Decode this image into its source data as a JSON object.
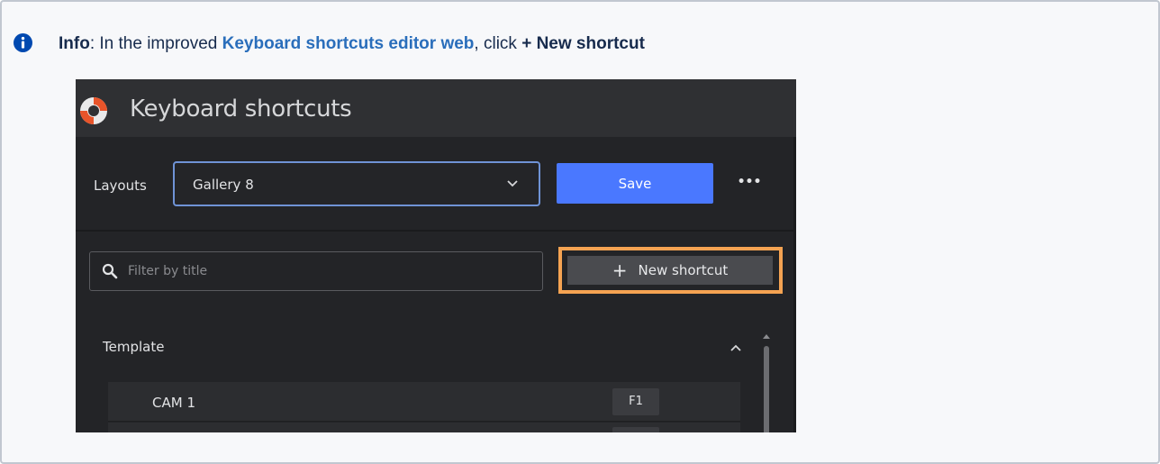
{
  "info": {
    "label": "Info",
    "sep": ": ",
    "text_before": "In the improved ",
    "link_text": "Keyboard shortcuts editor web",
    "text_middle": ", click ",
    "action_text": "+ New shortcut"
  },
  "app": {
    "title": "Keyboard shortcuts",
    "layouts_label": "Layouts",
    "layout_value": "Gallery 8",
    "save_label": "Save",
    "more_label": "•••",
    "filter_placeholder": "Filter by title",
    "new_shortcut_plus": "+",
    "new_shortcut_label": "New shortcut",
    "group_title": "Template",
    "rows": [
      {
        "name": "CAM 1",
        "key": "F1"
      },
      {
        "name": "",
        "key": ""
      }
    ]
  },
  "colors": {
    "accent_blue": "#4a78ff",
    "highlight_orange": "#f5a352",
    "link_blue": "#2a6ebb",
    "info_icon_blue": "#0049b0"
  },
  "icons": [
    "info-icon",
    "app-logo-icon",
    "chevron-down-icon",
    "more-icon",
    "search-icon",
    "plus-icon",
    "chevron-up-icon",
    "scroll-up-arrow-icon"
  ]
}
